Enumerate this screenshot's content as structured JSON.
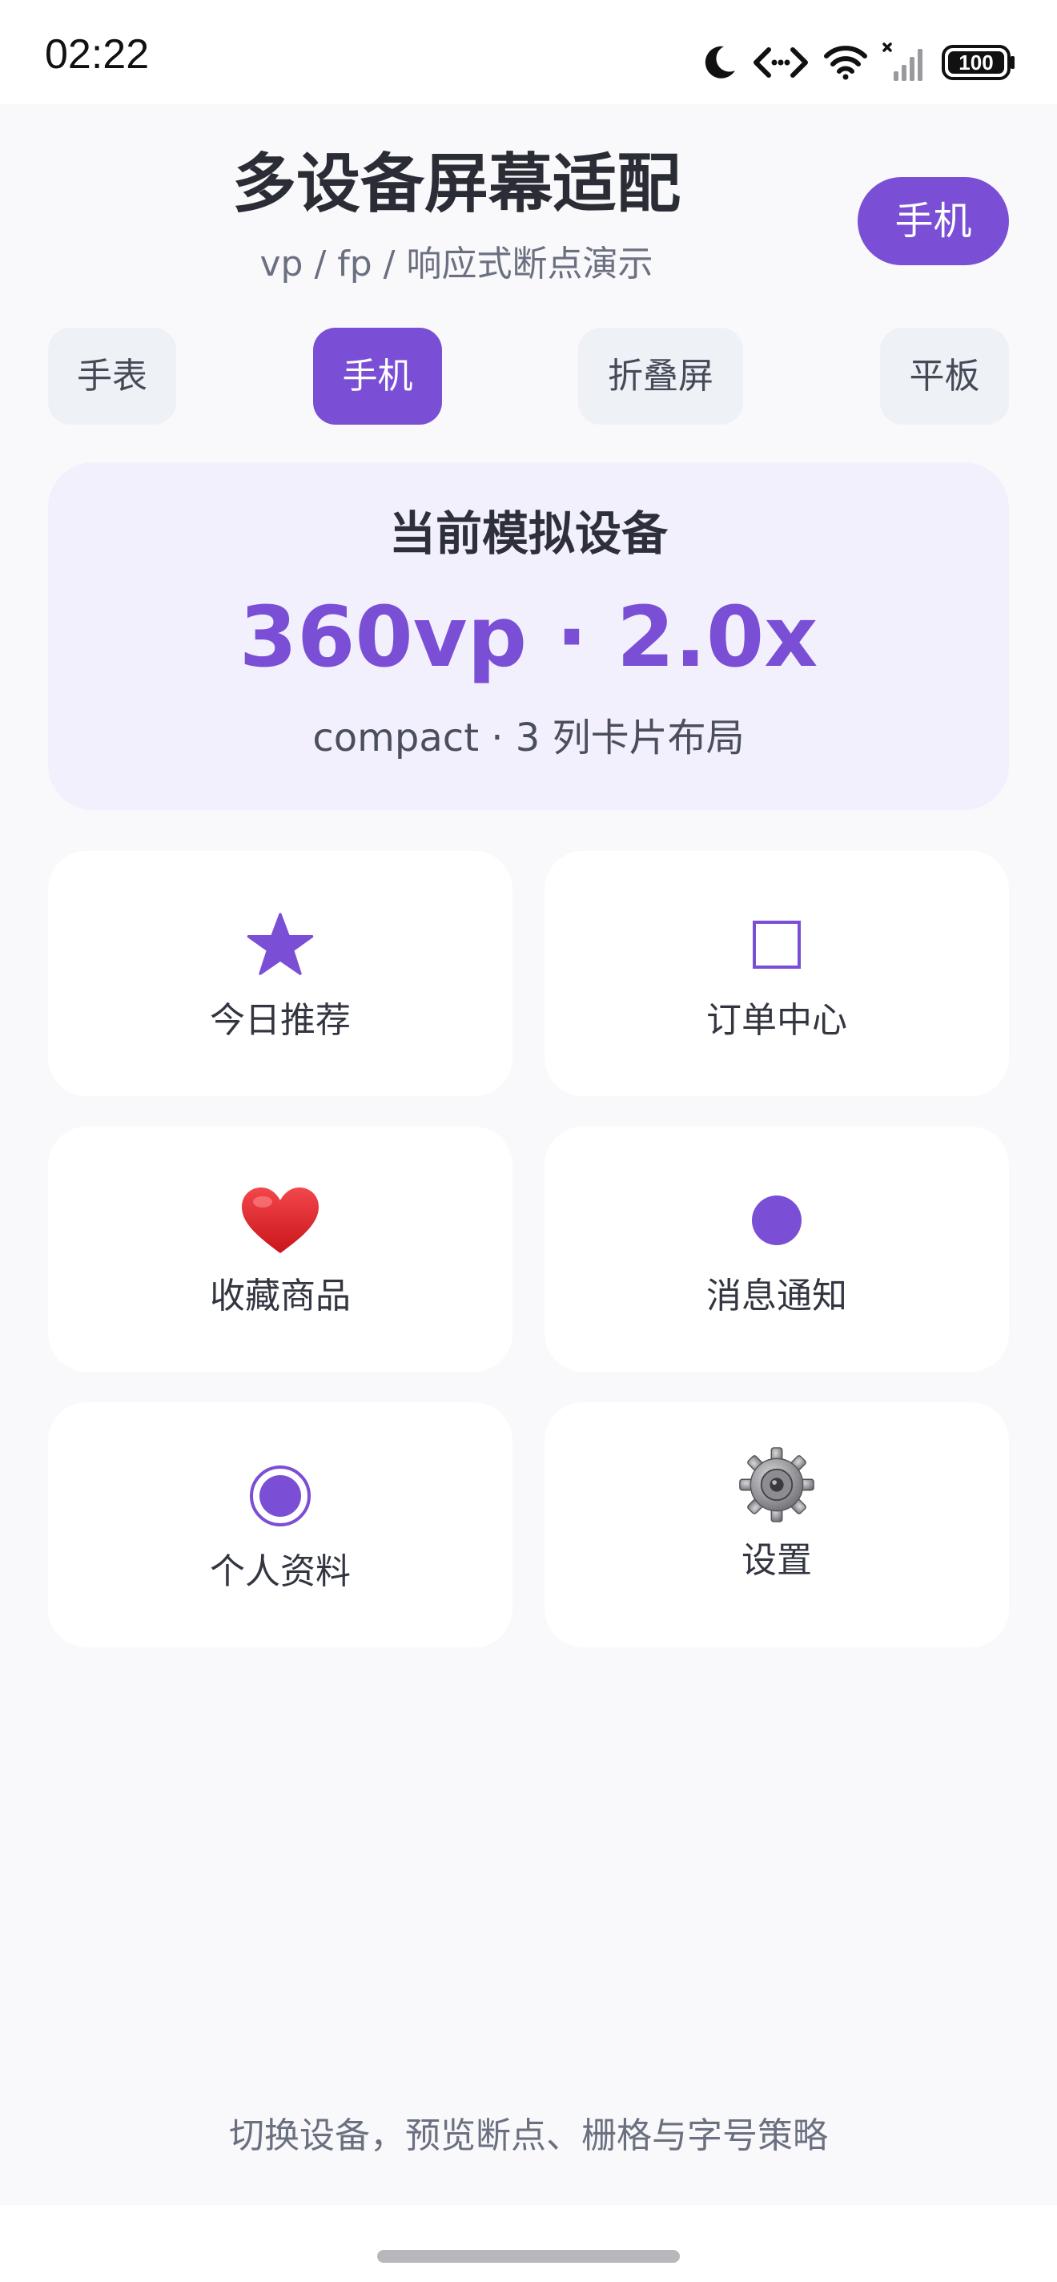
{
  "status_bar": {
    "time": "02:22",
    "battery": "100",
    "icons": [
      "moon-icon",
      "code-icon",
      "wifi-icon",
      "signal-icon",
      "battery-icon"
    ]
  },
  "header": {
    "title": "多设备屏幕适配",
    "subtitle": "vp / fp / 响应式断点演示",
    "current_device": "手机"
  },
  "device_tabs": [
    {
      "label": "手表",
      "active": false
    },
    {
      "label": "手机",
      "active": true
    },
    {
      "label": "折叠屏",
      "active": false
    },
    {
      "label": "平板",
      "active": false
    }
  ],
  "info_card": {
    "heading": "当前模拟设备",
    "value": "360vp · 2.0x",
    "layout": "compact · 3 列卡片布局"
  },
  "tiles": [
    {
      "label": "今日推荐",
      "icon": "star-icon"
    },
    {
      "label": "订单中心",
      "icon": "square-icon"
    },
    {
      "label": "收藏商品",
      "icon": "heart-icon"
    },
    {
      "label": "消息通知",
      "icon": "dot-icon"
    },
    {
      "label": "个人资料",
      "icon": "radio-icon"
    },
    {
      "label": "设置",
      "icon": "gear-icon"
    }
  ],
  "footer": {
    "text": "切换设备，预览断点、栅格与字号策略"
  },
  "colors": {
    "accent": "#7a4fd6",
    "tab_bg": "#eef1f5",
    "info_bg": "#f3f0fd",
    "page_bg": "#f9f9fb",
    "heart": "#e0242a"
  }
}
